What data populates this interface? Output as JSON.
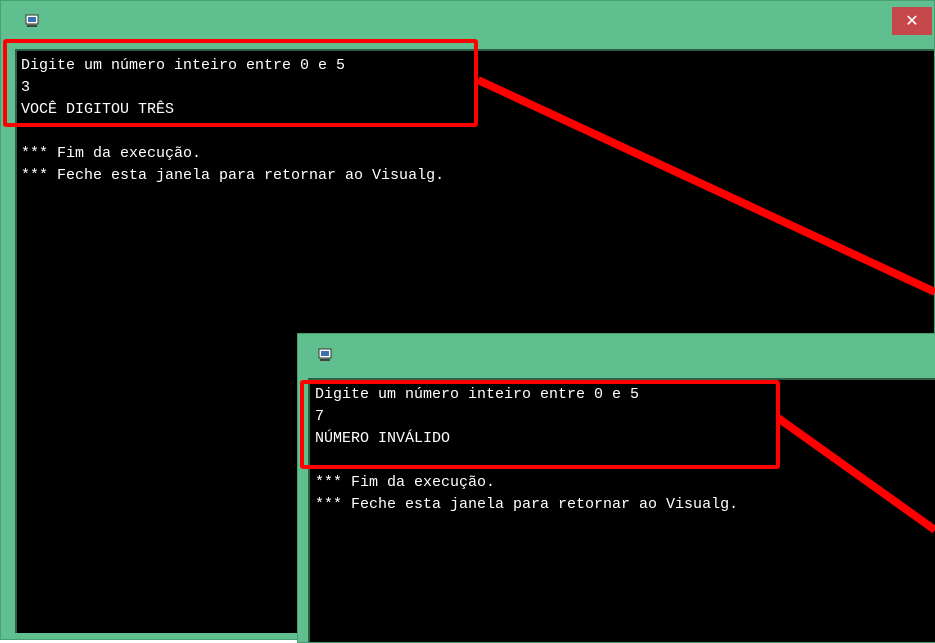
{
  "window_top": {
    "close_label": "✕",
    "icon": "computer-icon",
    "console_lines": [
      "Digite um número inteiro entre 0 e 5",
      "3",
      "VOCÊ DIGITOU TRÊS",
      "",
      "*** Fim da execução.",
      "*** Feche esta janela para retornar ao Visualg."
    ]
  },
  "window_bottom": {
    "icon": "computer-icon",
    "console_lines": [
      "Digite um número inteiro entre 0 e 5",
      "7",
      "NÚMERO INVÁLIDO",
      "",
      "*** Fim da execução.",
      "*** Feche esta janela para retornar ao Visualg."
    ]
  },
  "colors": {
    "window_frame": "#5fbf8f",
    "console_bg": "#000000",
    "console_text": "#ffffff",
    "highlight": "#ff0000",
    "close_button": "#c7484a"
  }
}
